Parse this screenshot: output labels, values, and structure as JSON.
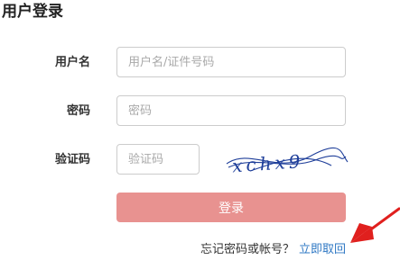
{
  "page": {
    "title": "用户登录"
  },
  "form": {
    "username": {
      "label": "用户名",
      "placeholder": "用户名/证件号码",
      "value": ""
    },
    "password": {
      "label": "密码",
      "placeholder": "密码",
      "value": ""
    },
    "captcha": {
      "label": "验证码",
      "placeholder": "验证码",
      "value": "",
      "image_text": "xchx9",
      "image_color": "#1f3f9a"
    },
    "login_button_label": "登录",
    "login_button_color": "#e89290"
  },
  "forgot": {
    "text": "忘记密码或帐号？",
    "link_label": "立即取回",
    "link_color": "#2f78c4"
  },
  "annotation": {
    "arrow_color": "#e0201e",
    "arrow_icon": "red-arrow-pointer"
  }
}
